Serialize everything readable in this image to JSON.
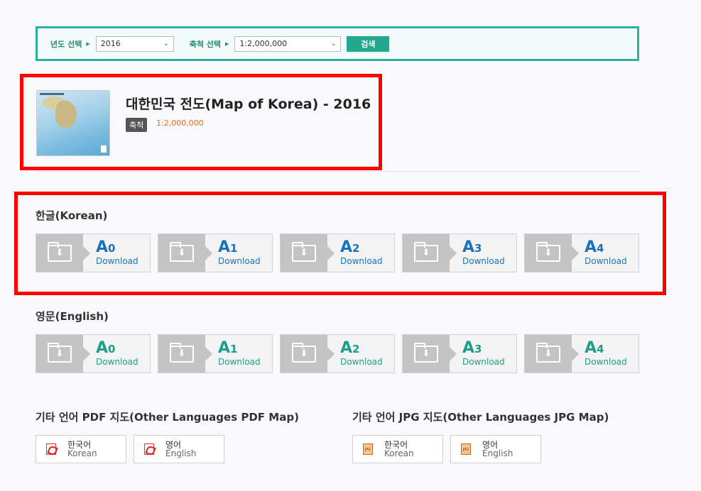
{
  "filter": {
    "year_label": "년도 선택",
    "year_value": "2016",
    "scale_label": "축척 선택",
    "scale_value": "1:2,000,000",
    "search_label": "검색"
  },
  "map": {
    "title": "대한민국 전도(Map of Korea) - 2016",
    "scale_badge": "축척",
    "scale_value": "1:2,000,000"
  },
  "korean_section": {
    "title": "한글(Korean)",
    "items": [
      {
        "size": "A",
        "num": "0",
        "sub": "Download"
      },
      {
        "size": "A",
        "num": "1",
        "sub": "Download"
      },
      {
        "size": "A",
        "num": "2",
        "sub": "Download"
      },
      {
        "size": "A",
        "num": "3",
        "sub": "Download"
      },
      {
        "size": "A",
        "num": "4",
        "sub": "Download"
      }
    ]
  },
  "english_section": {
    "title": "영문(English)",
    "items": [
      {
        "size": "A",
        "num": "0",
        "sub": "Download"
      },
      {
        "size": "A",
        "num": "1",
        "sub": "Download"
      },
      {
        "size": "A",
        "num": "2",
        "sub": "Download"
      },
      {
        "size": "A",
        "num": "3",
        "sub": "Download"
      },
      {
        "size": "A",
        "num": "4",
        "sub": "Download"
      }
    ]
  },
  "other_pdf": {
    "title": "기타 언어 PDF 지도(Other Languages PDF Map)",
    "items": [
      {
        "main": "한국어",
        "sub": "Korean"
      },
      {
        "main": "영어",
        "sub": "English"
      }
    ]
  },
  "other_jpg": {
    "title": "기타 언어 JPG 지도(Other Languages JPG Map)",
    "items": [
      {
        "main": "한국어",
        "sub": "Korean"
      },
      {
        "main": "영어",
        "sub": "English"
      }
    ]
  },
  "colors": {
    "accent_teal": "#2bb19d",
    "korean_blue": "#1a73b9",
    "english_teal": "#1b9f8c",
    "highlight_red": "#ff0000",
    "scale_orange": "#e96a1c"
  }
}
